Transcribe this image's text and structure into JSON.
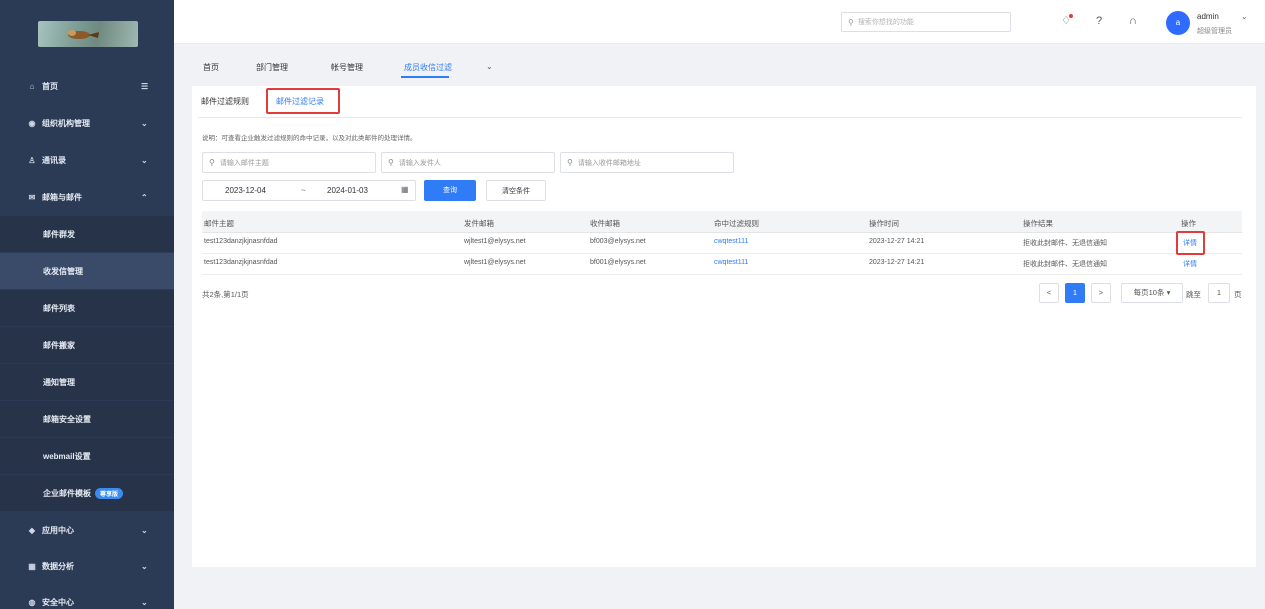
{
  "sidebar": {
    "items": [
      {
        "icon": "home-icon",
        "label": "首页",
        "chev": "☰"
      },
      {
        "icon": "org-icon",
        "label": "组织机构管理",
        "chev": "⌄"
      },
      {
        "icon": "contacts-icon",
        "label": "通讯录",
        "chev": "⌄"
      },
      {
        "icon": "mail-icon",
        "label": "邮箱与邮件",
        "chev": "⌃"
      }
    ],
    "subitems": [
      {
        "label": "邮件群发"
      },
      {
        "label": "收发信管理",
        "active": true
      },
      {
        "label": "邮件列表"
      },
      {
        "label": "邮件搬家"
      },
      {
        "label": "通知管理"
      },
      {
        "label": "邮箱安全设置"
      },
      {
        "label": "webmail设置"
      },
      {
        "label": "企业邮件模板",
        "badge": "尊享版"
      }
    ],
    "bottom_items": [
      {
        "icon": "app-center-icon",
        "label": "应用中心",
        "chev": "⌄"
      },
      {
        "icon": "analytics-icon",
        "label": "数据分析",
        "chev": "⌄"
      },
      {
        "icon": "security-icon",
        "label": "安全中心",
        "chev": "⌄"
      }
    ]
  },
  "topbar": {
    "search_placeholder": "搜索你想找的功能",
    "user_avatar": "a",
    "user_name": "admin",
    "user_role": "超级管理员"
  },
  "main_tabs": [
    {
      "label": "首页"
    },
    {
      "label": "部门管理"
    },
    {
      "label": "帐号管理"
    },
    {
      "label": "成员收信过滤",
      "active": true
    }
  ],
  "sub_tabs": [
    {
      "label": "邮件过滤规则"
    },
    {
      "label": "邮件过滤记录",
      "active": true
    }
  ],
  "description": "说明：可查看企业触发过滤规则的命中记录，以及对此类邮件的处理详情。",
  "filters": {
    "subject_placeholder": "请输入邮件主题",
    "sender_placeholder": "请输入发件人",
    "recipient_placeholder": "请输入收件邮箱地址",
    "date_start": "2023-12-04",
    "date_sep": "~",
    "date_end": "2024-01-03",
    "query_button": "查询",
    "clear_button": "清空条件"
  },
  "table": {
    "columns": [
      "邮件主题",
      "发件邮箱",
      "收件邮箱",
      "命中过滤规则",
      "操作时间",
      "操作结果",
      "操作"
    ],
    "rows": [
      [
        "test123danzjkjnasnfdad",
        "wjltest1@elysys.net",
        "bf003@elysys.net",
        "cwqtest111",
        "2023-12-27 14:21",
        "拒收此封邮件、无退信通知",
        "详情"
      ],
      [
        "test123danzjkjnasnfdad",
        "wjltest1@elysys.net",
        "bf001@elysys.net",
        "cwqtest111",
        "2023-12-27 14:21",
        "拒收此封邮件、无退信通知",
        "详情"
      ]
    ]
  },
  "pagination": {
    "total_text": "共2条,第1/1页",
    "prev": "<",
    "current": "1",
    "next": ">",
    "page_size": "每页10条",
    "jump_label": "跳至",
    "jump_value": "1",
    "page_suffix": "页"
  },
  "colors": {
    "accent": "#2f7cf6",
    "sidebar_bg": "#2b3a55",
    "highlight": "#e23b3b"
  }
}
